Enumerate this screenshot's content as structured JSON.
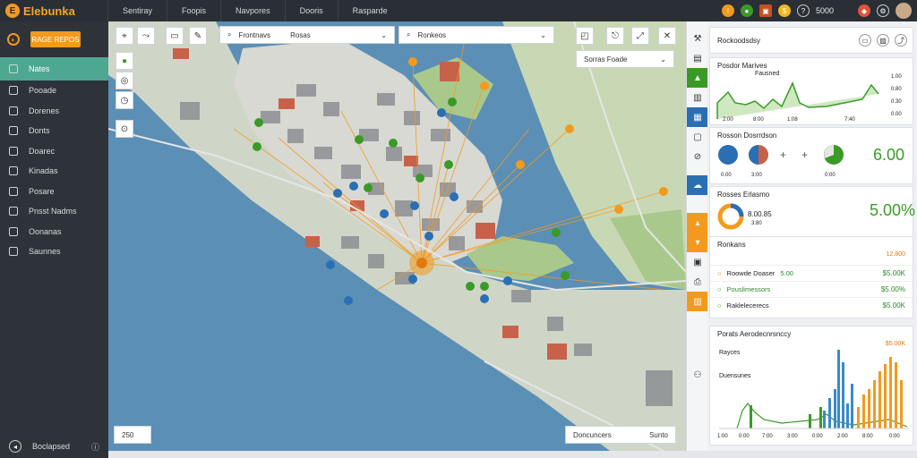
{
  "app": {
    "name": "Elebunka",
    "logo_letter": "E"
  },
  "topnav": [
    "Sentiray",
    "Foopis",
    "Navpores",
    "Dooris",
    "Rasparde"
  ],
  "topright": {
    "value": "5000"
  },
  "sidebar": {
    "button": "RAGE REPOS",
    "items": [
      "Nates",
      "Pooade",
      "Dorenes",
      "Donts",
      "Doarec",
      "Kinadas",
      "Posare",
      "Pnsst Nadms",
      "Oonanas",
      "Saunnes"
    ],
    "footer": "Boclapsed"
  },
  "map": {
    "search1": "Frontnavs",
    "search1_value": "Rosas",
    "search2": "Ronkeos",
    "popup": "Sorras Foade",
    "zoom": "250",
    "footer_label": "Doncuncers",
    "footer_value": "Sunto"
  },
  "panel": {
    "header": "Rockoodsdsy",
    "card1": {
      "title": "Posdor Marives",
      "legend": "Fausned",
      "ticks_y": [
        "1.00",
        "0.80",
        "0.30",
        "0.00"
      ],
      "ticks_x": [
        "2:00",
        "8:00",
        "1:08",
        "7:40"
      ]
    },
    "card2": {
      "title": "Rosson Dosrrdson",
      "labels": [
        "0.00",
        "3:00",
        "0:00"
      ],
      "value": "6.00"
    },
    "card3": {
      "title": "Rosses Erlasmo",
      "center": "8.00.85",
      "sub": "3:80",
      "value": "5.00%"
    },
    "card4": {
      "title": "Ronkans",
      "topval": "12.800",
      "rows": [
        {
          "label": "Roowde Doaser",
          "mid": "5.00",
          "value": "$5.00K"
        },
        {
          "label": "Pouslimessors",
          "mid": "",
          "value": "$5.00%"
        },
        {
          "label": "Raklelecerecs",
          "mid": "",
          "value": "$5.00K"
        }
      ]
    },
    "card5": {
      "title": "Porats Aerodecnrsnccy",
      "topval": "$5.00K",
      "legend1": "Rayces",
      "legend2": "Duensunes",
      "ticks_x": [
        "1:00",
        "0:00",
        "7:00",
        "3:00",
        "0:00",
        "2:00",
        "8:00",
        "0:00"
      ]
    }
  },
  "colors": {
    "accent": "#f39a1e",
    "green": "#3a9a28",
    "teal": "#4ea891",
    "blue": "#2a6fb3",
    "water": "#5b8fb5"
  }
}
